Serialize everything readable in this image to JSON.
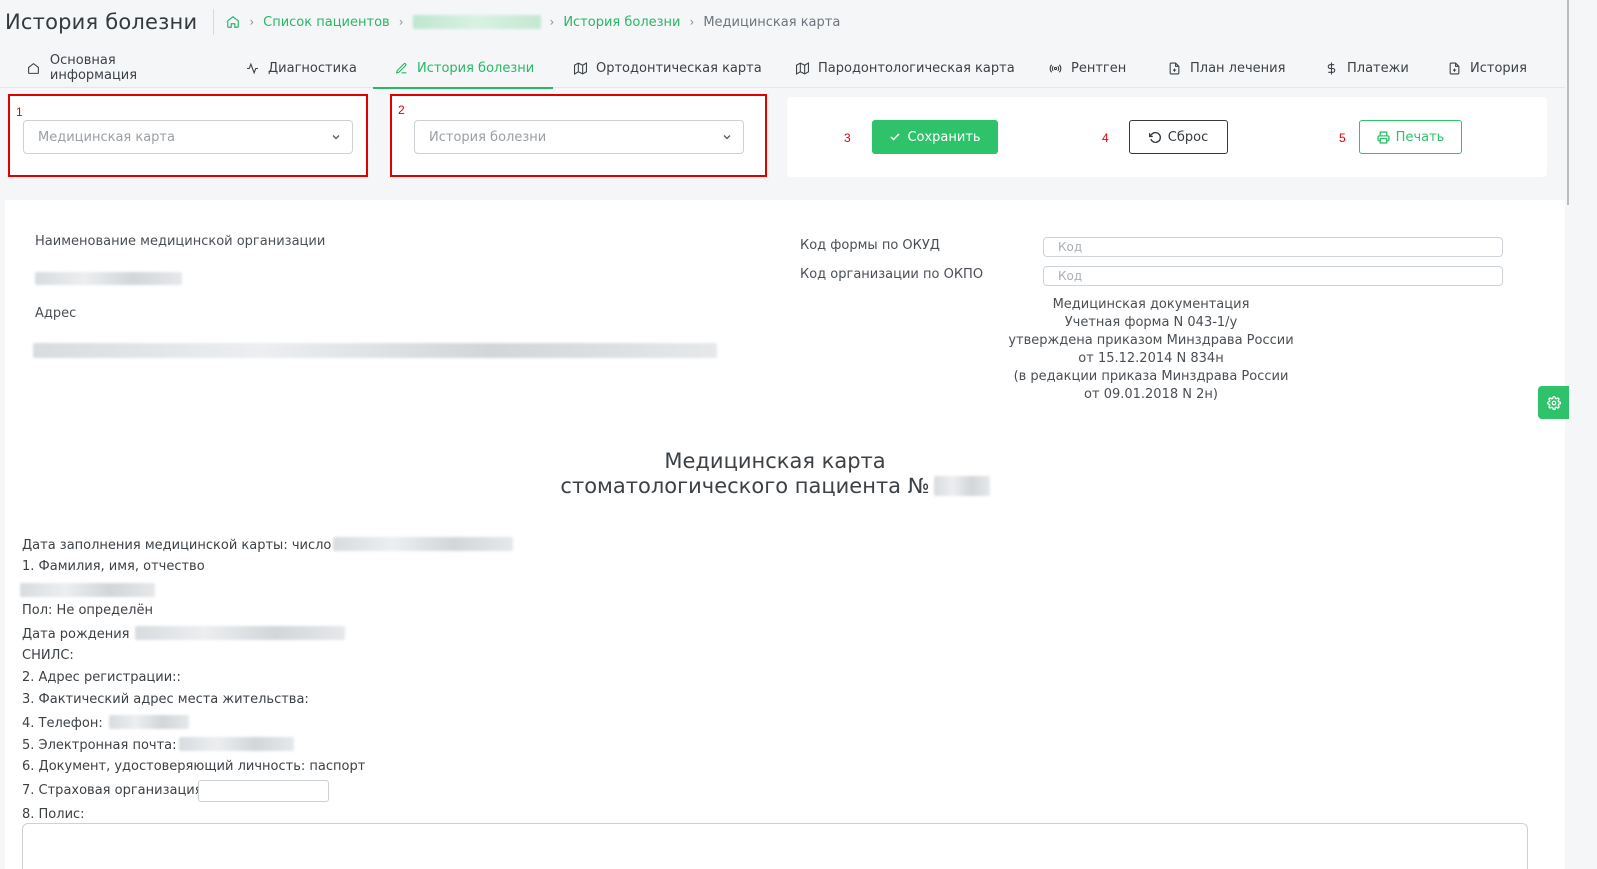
{
  "header": {
    "title": "История болезни",
    "breadcrumb": {
      "patients_list": "Список пациентов",
      "history": "История болезни",
      "current": "Медицинская карта"
    }
  },
  "tabs": [
    {
      "label": "Основная информация",
      "icon": "home-icon"
    },
    {
      "label": "Диагностика",
      "icon": "activity-icon"
    },
    {
      "label": "История болезни",
      "icon": "pen-icon",
      "active": true
    },
    {
      "label": "Ортодонтическая карта",
      "icon": "map-icon"
    },
    {
      "label": "Пародонтологическая карта",
      "icon": "map-icon"
    },
    {
      "label": "Рентген",
      "icon": "radio-icon"
    },
    {
      "label": "План лечения",
      "icon": "file-plus-icon"
    },
    {
      "label": "Платежи",
      "icon": "dollar-icon"
    },
    {
      "label": "История",
      "icon": "file-plus-icon"
    }
  ],
  "annotations": {
    "n1": "1",
    "n2": "2",
    "n3": "3",
    "n4": "4",
    "n5": "5"
  },
  "selects": {
    "card": {
      "placeholder": "Медицинская карта"
    },
    "history": {
      "placeholder": "История болезни"
    }
  },
  "actions": {
    "save": "Сохранить",
    "reset": "Сброс",
    "print": "Печать"
  },
  "doc": {
    "org_name_label": "Наименование медицинской организации",
    "address_label": "Адрес",
    "okud_label": "Код формы по ОКУД",
    "okpo_label": "Код организации по ОКПО",
    "code_placeholder": "Код",
    "regulation": [
      "Медицинская документация",
      "Учетная форма N 043-1/у",
      "утверждена приказом Минздрава России",
      "от 15.12.2014 N 834н",
      "(в редакции приказа Минздрава России",
      "от 09.01.2018 N 2н)"
    ],
    "title_line1": "Медицинская карта",
    "title_line2": "стоматологического пациента №",
    "fields": {
      "fill_date": "Дата заполнения медицинской карты: число",
      "fio": "1. Фамилия, имя, отчество",
      "sex": "Пол: Не определён",
      "birth": "Дата рождения",
      "snils": "СНИЛС:",
      "reg_address": "2. Адрес регистрации::",
      "fact_address": "3. Фактический адрес места жительства:",
      "phone": "4. Телефон:",
      "email": "5. Электронная почта:",
      "document": "6. Документ, удостоверяющий личность: паспорт",
      "insurance": "7. Страховая организация:",
      "policy": "8. Полис:"
    }
  },
  "colors": {
    "accent": "#2ec36a",
    "annotation": "#e00000"
  }
}
